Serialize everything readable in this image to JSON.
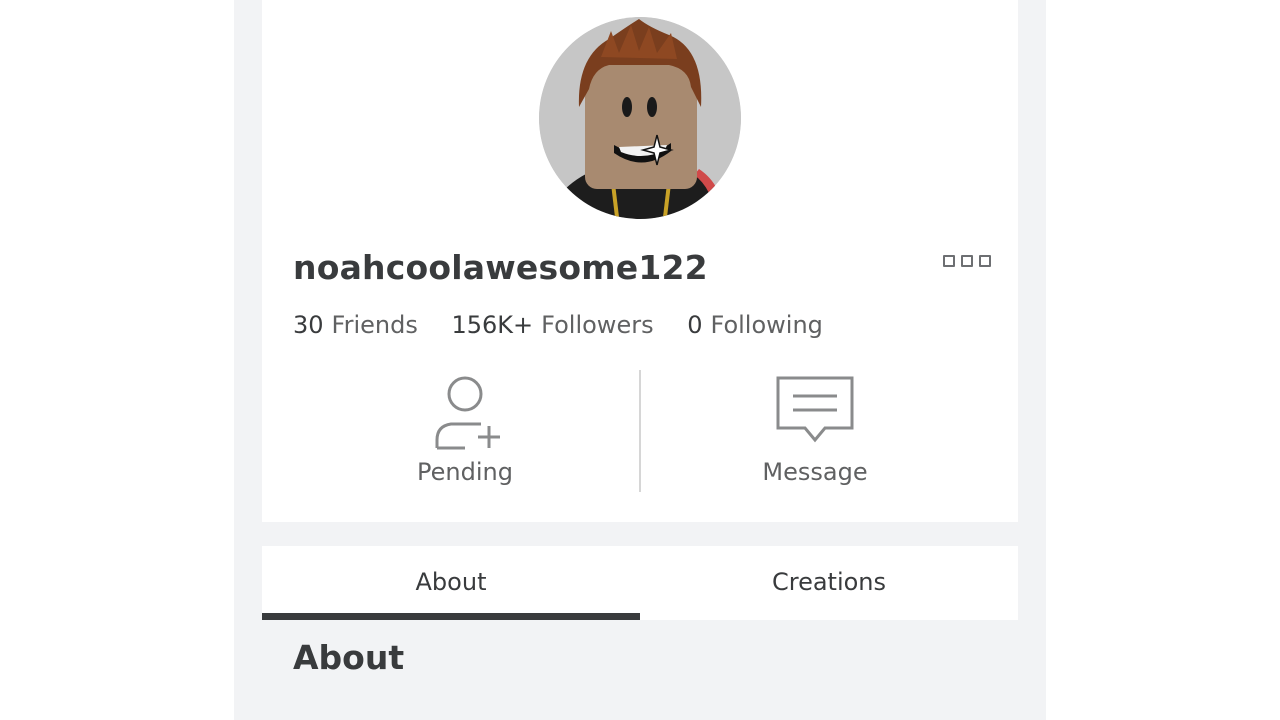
{
  "profile": {
    "username": "noahcoolawesome122",
    "more_icon": "ellipsis-icon",
    "stats": {
      "friends_count": "30",
      "friends_label": "Friends",
      "followers_count": "156K+",
      "followers_label": "Followers",
      "following_count": "0",
      "following_label": "Following"
    },
    "actions": {
      "pending_label": "Pending",
      "pending_icon": "add-friend-icon",
      "message_label": "Message",
      "message_icon": "message-icon"
    }
  },
  "tabs": [
    {
      "label": "About",
      "active": true
    },
    {
      "label": "Creations",
      "active": false
    }
  ],
  "section": {
    "title": "About"
  },
  "colors": {
    "text_primary": "#393b3d",
    "text_secondary": "#606162",
    "page_background": "#f2f3f5",
    "avatar_background": "#c8c8c8"
  }
}
